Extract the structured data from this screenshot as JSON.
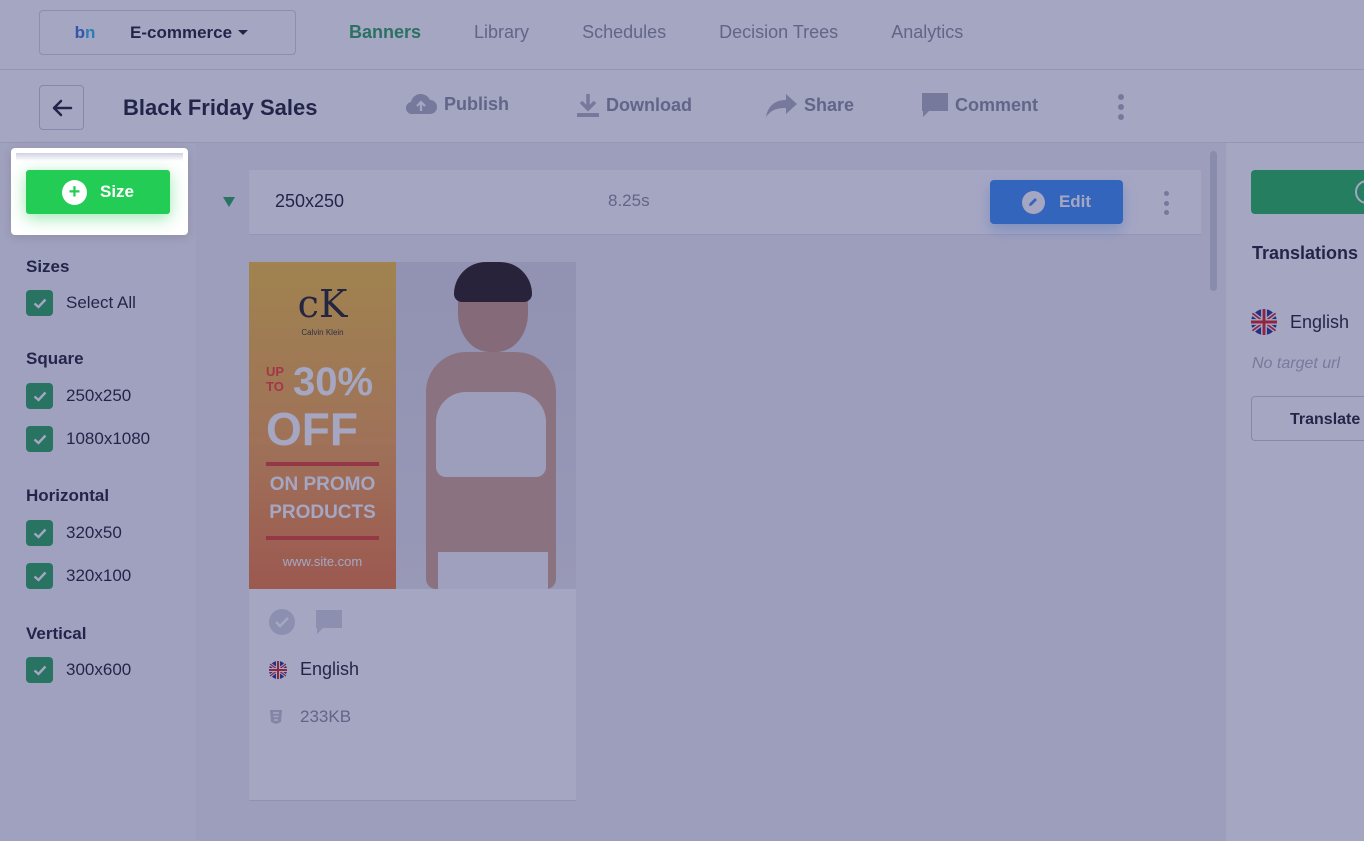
{
  "workspace": {
    "logo_b": "b",
    "logo_n": "n",
    "name": "E-commerce"
  },
  "nav": {
    "tabs": [
      {
        "label": "Banners",
        "active": true
      },
      {
        "label": "Library",
        "active": false
      },
      {
        "label": "Schedules",
        "active": false
      },
      {
        "label": "Decision Trees",
        "active": false
      },
      {
        "label": "Analytics",
        "active": false
      }
    ]
  },
  "toolbar": {
    "title": "Black Friday Sales",
    "publish": "Publish",
    "download": "Download",
    "share": "Share",
    "comment": "Comment"
  },
  "sidebar": {
    "size_button": "Size",
    "sections": [
      {
        "heading": "Sizes",
        "items": [
          "Select All"
        ]
      },
      {
        "heading": "Square",
        "items": [
          "250x250",
          "1080x1080"
        ]
      },
      {
        "heading": "Horizontal",
        "items": [
          "320x50",
          "320x100"
        ]
      },
      {
        "heading": "Vertical",
        "items": [
          "300x600"
        ]
      }
    ]
  },
  "banner_row": {
    "size": "250x250",
    "duration": "8.25s",
    "edit_label": "Edit",
    "language": "English",
    "weight": "233KB"
  },
  "banner_creative": {
    "brand": "cK",
    "brand_sub": "Calvin Klein",
    "upto": "UP TO",
    "percent": "30%",
    "off": "OFF",
    "promo_line1": "ON PROMO",
    "promo_line2": "PRODUCTS",
    "site": "www.site.com"
  },
  "right_panel": {
    "translations_heading": "Translations",
    "language": "English",
    "no_target_url": "No target url",
    "translate_button": "Translate"
  },
  "colors": {
    "accent_green": "#22cc55",
    "nav_active": "#2fa35a",
    "edit_blue": "#3c8ff7",
    "overlay": "#282a6e"
  }
}
